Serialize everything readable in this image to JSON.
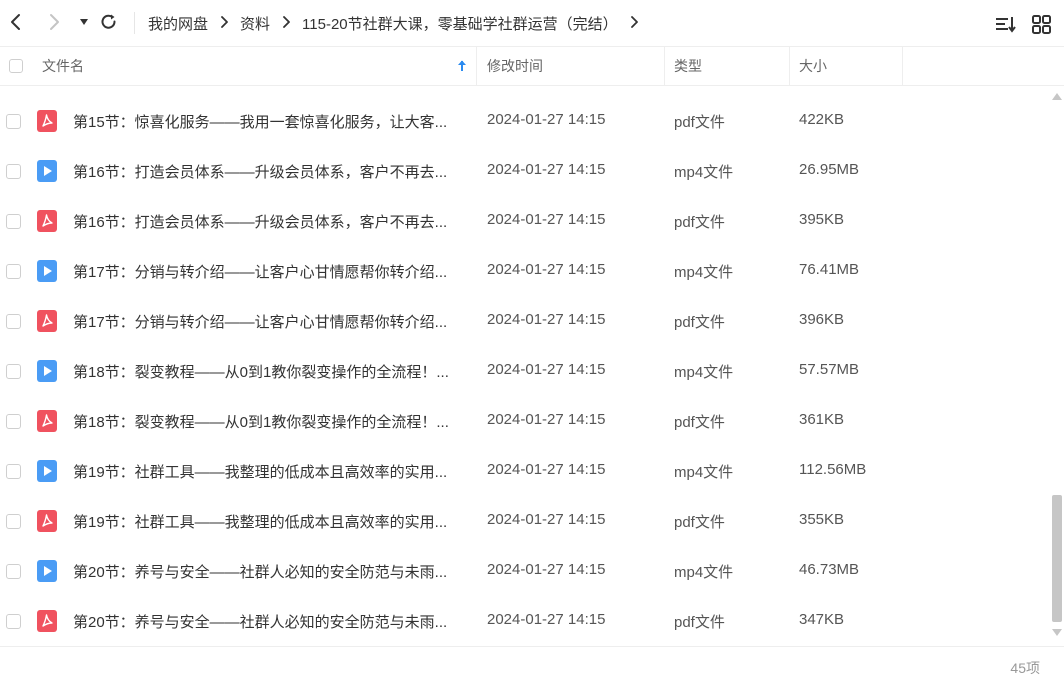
{
  "breadcrumb": [
    "我的网盘",
    "资料",
    "115-20节社群大课，零基础学社群运营（完结）"
  ],
  "header": {
    "name": "文件名",
    "time": "修改时间",
    "type": "类型",
    "size": "大小"
  },
  "colors": {
    "pdf": "#f0525f",
    "mp4": "#4a9cf5",
    "sort_arrow": "#2b8bf0"
  },
  "files": [
    {
      "name": "第15节：惊喜化服务——我用一套惊喜化服务，让大客...",
      "time": "2024-01-27 14:15",
      "type": "pdf文件",
      "size": "422KB",
      "icon": "pdf-icon"
    },
    {
      "name": "第16节：打造会员体系——升级会员体系，客户不再去...",
      "time": "2024-01-27 14:15",
      "type": "mp4文件",
      "size": "26.95MB",
      "icon": "video-icon"
    },
    {
      "name": "第16节：打造会员体系——升级会员体系，客户不再去...",
      "time": "2024-01-27 14:15",
      "type": "pdf文件",
      "size": "395KB",
      "icon": "pdf-icon"
    },
    {
      "name": "第17节：分销与转介绍——让客户心甘情愿帮你转介绍...",
      "time": "2024-01-27 14:15",
      "type": "mp4文件",
      "size": "76.41MB",
      "icon": "video-icon"
    },
    {
      "name": "第17节：分销与转介绍——让客户心甘情愿帮你转介绍...",
      "time": "2024-01-27 14:15",
      "type": "pdf文件",
      "size": "396KB",
      "icon": "pdf-icon"
    },
    {
      "name": "第18节：裂变教程——从0到1教你裂变操作的全流程！...",
      "time": "2024-01-27 14:15",
      "type": "mp4文件",
      "size": "57.57MB",
      "icon": "video-icon"
    },
    {
      "name": "第18节：裂变教程——从0到1教你裂变操作的全流程！...",
      "time": "2024-01-27 14:15",
      "type": "pdf文件",
      "size": "361KB",
      "icon": "pdf-icon"
    },
    {
      "name": "第19节：社群工具——我整理的低成本且高效率的实用...",
      "time": "2024-01-27 14:15",
      "type": "mp4文件",
      "size": "112.56MB",
      "icon": "video-icon"
    },
    {
      "name": "第19节：社群工具——我整理的低成本且高效率的实用...",
      "time": "2024-01-27 14:15",
      "type": "pdf文件",
      "size": "355KB",
      "icon": "pdf-icon"
    },
    {
      "name": "第20节：养号与安全——社群人必知的安全防范与未雨...",
      "time": "2024-01-27 14:15",
      "type": "mp4文件",
      "size": "46.73MB",
      "icon": "video-icon"
    },
    {
      "name": "第20节：养号与安全——社群人必知的安全防范与未雨...",
      "time": "2024-01-27 14:15",
      "type": "pdf文件",
      "size": "347KB",
      "icon": "pdf-icon"
    }
  ],
  "footer": {
    "count": "45项"
  }
}
